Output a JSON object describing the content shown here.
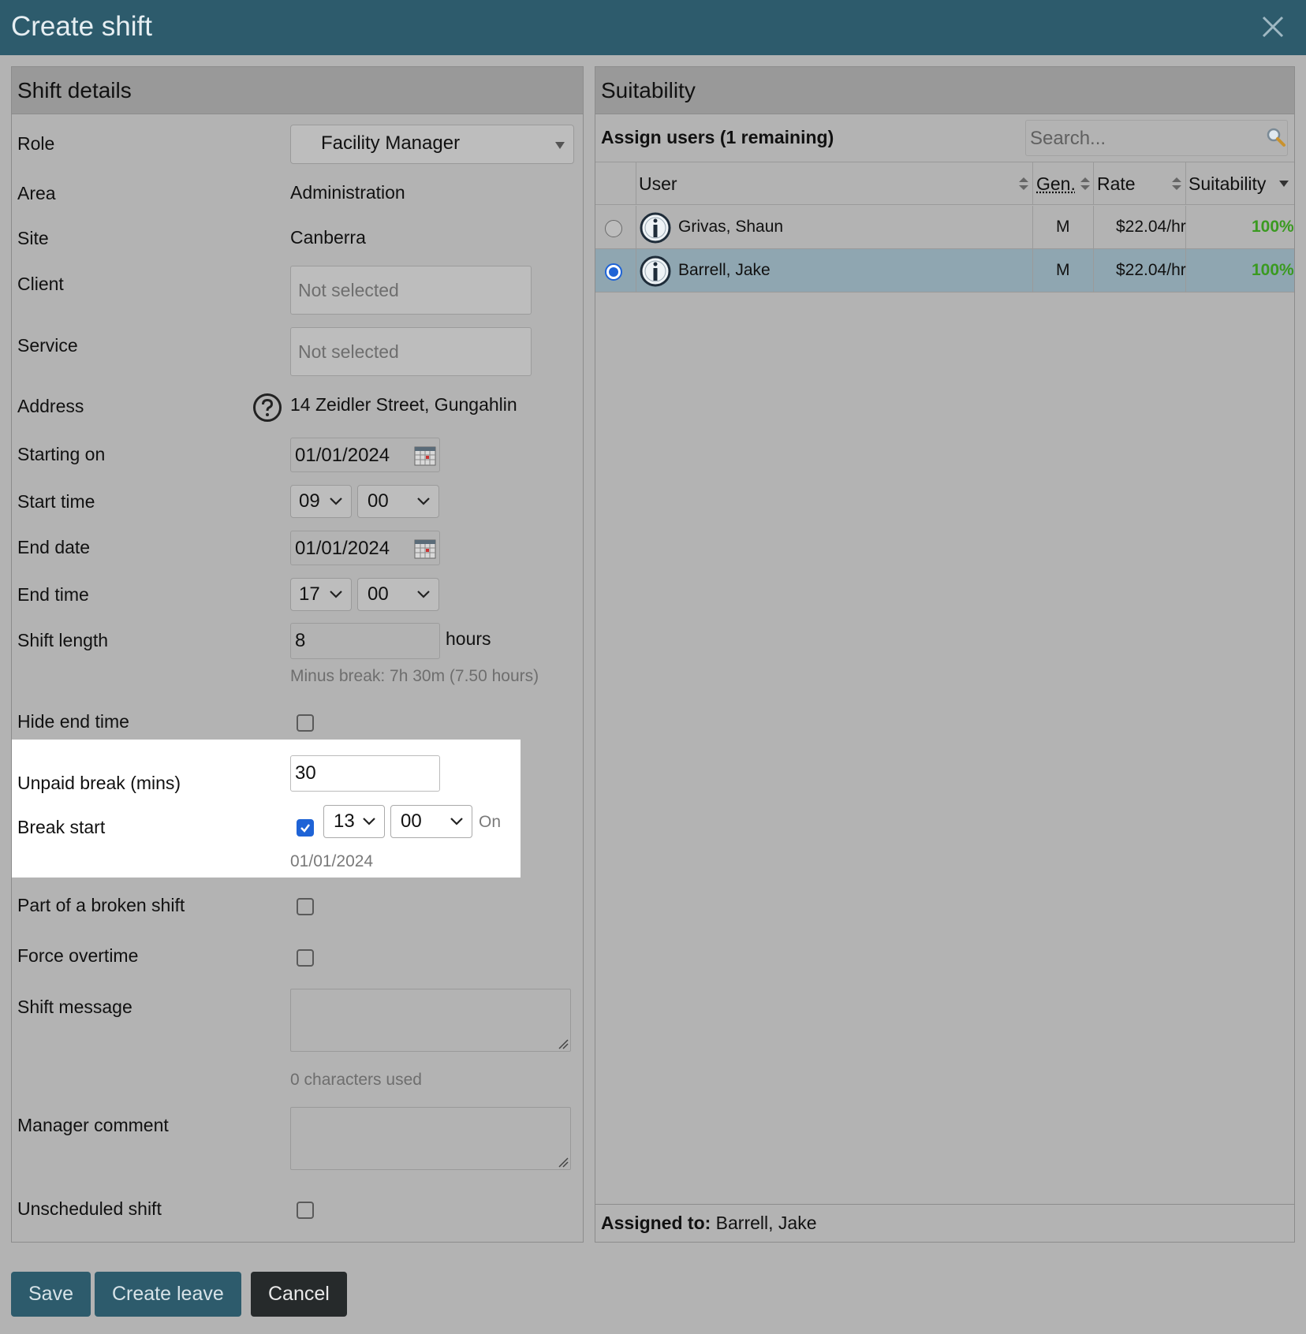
{
  "dialog": {
    "title": "Create shift"
  },
  "shift_details": {
    "header": "Shift details",
    "role": {
      "label": "Role",
      "value": "Facility Manager"
    },
    "area": {
      "label": "Area",
      "value": "Administration"
    },
    "site": {
      "label": "Site",
      "value": "Canberra"
    },
    "client": {
      "label": "Client",
      "placeholder": "Not selected"
    },
    "service": {
      "label": "Service",
      "placeholder": "Not selected"
    },
    "address": {
      "label": "Address",
      "value": "14 Zeidler Street, Gungahlin"
    },
    "starting_on": {
      "label": "Starting on",
      "value": "01/01/2024"
    },
    "start_time": {
      "label": "Start time",
      "hour": "09",
      "minute": "00"
    },
    "end_date": {
      "label": "End date",
      "value": "01/01/2024"
    },
    "end_time": {
      "label": "End time",
      "hour": "17",
      "minute": "00"
    },
    "shift_length": {
      "label": "Shift length",
      "value": "8",
      "unit": "hours",
      "hint": "Minus break: 7h 30m (7.50 hours)"
    },
    "hide_end_time": {
      "label": "Hide end time",
      "checked": false
    },
    "unpaid_break": {
      "label": "Unpaid break (mins)",
      "value": "30"
    },
    "break_start": {
      "label": "Break start",
      "checked": true,
      "hour": "13",
      "minute": "00",
      "on_label": "On",
      "date": "01/01/2024"
    },
    "broken_shift": {
      "label": "Part of a broken shift",
      "checked": false
    },
    "force_overtime": {
      "label": "Force overtime",
      "checked": false
    },
    "shift_message": {
      "label": "Shift message",
      "hint": "0 characters used"
    },
    "manager_comment": {
      "label": "Manager comment"
    },
    "unscheduled_shift": {
      "label": "Unscheduled shift",
      "checked": false
    }
  },
  "suitability": {
    "header": "Suitability",
    "assign_title": "Assign users (1 remaining)",
    "search_placeholder": "Search...",
    "columns": {
      "user": "User",
      "gender": "Gen.",
      "rate": "Rate",
      "suitability": "Suitability"
    },
    "rows": [
      {
        "name": "Grivas, Shaun",
        "gender": "M",
        "rate": "$22.04/hr",
        "suitability": "100%",
        "selected": false
      },
      {
        "name": "Barrell, Jake",
        "gender": "M",
        "rate": "$22.04/hr",
        "suitability": "100%",
        "selected": true
      }
    ],
    "assigned_label": "Assigned to:",
    "assigned_value": "Barrell, Jake"
  },
  "buttons": {
    "save": "Save",
    "create_leave": "Create leave",
    "cancel": "Cancel"
  },
  "colors": {
    "title_bar": "#2d5b6c",
    "accent": "#1e63d6",
    "suitability_green": "#3a9a20",
    "selected_row": "#8fa6b1"
  }
}
